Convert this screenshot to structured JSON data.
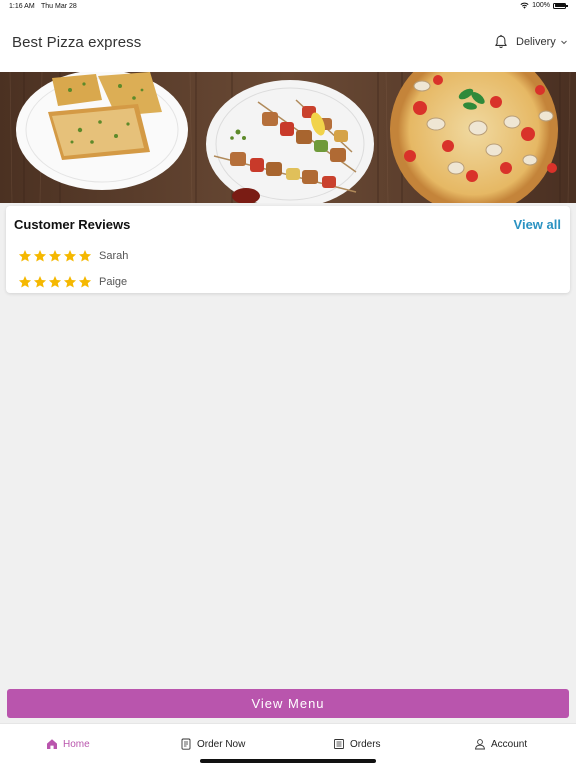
{
  "status_bar": {
    "time": "1:16 AM",
    "date": "Thu Mar 28",
    "battery": "100%"
  },
  "header": {
    "title": "Best Pizza express",
    "mode_label": "Delivery"
  },
  "hero": {
    "description_icons": [
      "garlic-bread-image",
      "skewers-image",
      "pizza-image"
    ]
  },
  "reviews": {
    "title": "Customer Reviews",
    "view_all_label": "View all",
    "items": [
      {
        "name": "Sarah",
        "stars": 5
      },
      {
        "name": "Paige",
        "stars": 5
      }
    ],
    "star_color": "#f5b800"
  },
  "view_menu_label": "View Menu",
  "accent_color": "#b955ad",
  "tabs": [
    {
      "label": "Home",
      "icon": "home-icon",
      "active": true
    },
    {
      "label": "Order Now",
      "icon": "order-icon",
      "active": false
    },
    {
      "label": "Orders",
      "icon": "orders-icon",
      "active": false
    },
    {
      "label": "Account",
      "icon": "account-icon",
      "active": false
    }
  ]
}
